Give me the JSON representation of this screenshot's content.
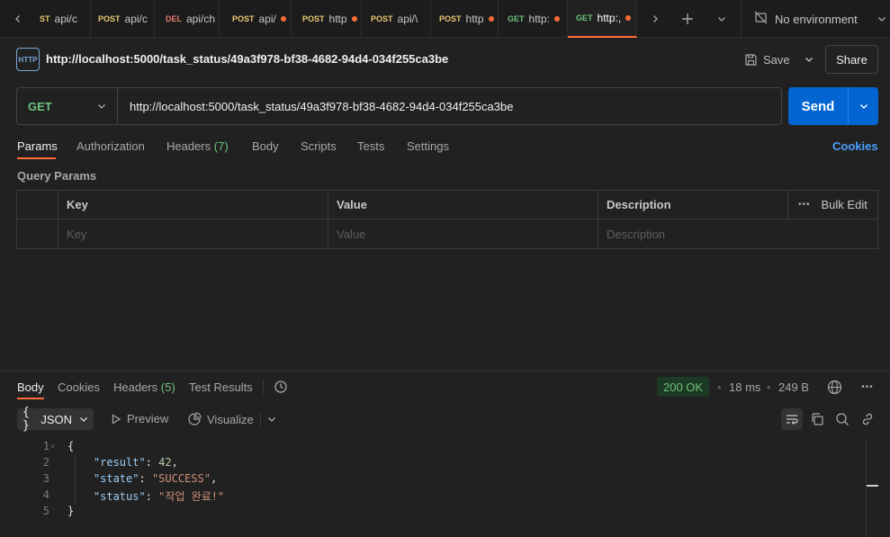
{
  "tabs": [
    {
      "method": "ST",
      "label": "api/c",
      "dot": false,
      "active": false
    },
    {
      "method": "POST",
      "label": "api/c",
      "dot": false,
      "active": false
    },
    {
      "method": "DEL",
      "label": "api/ch",
      "dot": false,
      "active": false
    },
    {
      "method": "POST",
      "label": "api/",
      "dot": true,
      "active": false
    },
    {
      "method": "POST",
      "label": "http",
      "dot": true,
      "active": false
    },
    {
      "method": "POST",
      "label": "api/\\",
      "dot": false,
      "active": false
    },
    {
      "method": "POST",
      "label": "http",
      "dot": true,
      "active": false
    },
    {
      "method": "GET",
      "label": "http:",
      "dot": true,
      "active": false
    },
    {
      "method": "GET",
      "label": "http:,",
      "dot": true,
      "active": true
    }
  ],
  "environment": "No environment",
  "request": {
    "title": "http://localhost:5000/task_status/49a3f978-bf38-4682-94d4-034f255ca3be",
    "method": "GET",
    "url": "http://localhost:5000/task_status/49a3f978-bf38-4682-94d4-034f255ca3be",
    "save_label": "Save",
    "share_label": "Share",
    "send_label": "Send"
  },
  "request_tabs": {
    "params": "Params",
    "authorization": "Authorization",
    "headers": "Headers",
    "headers_count": "(7)",
    "body": "Body",
    "scripts": "Scripts",
    "tests": "Tests",
    "settings": "Settings",
    "cookies": "Cookies"
  },
  "query_params": {
    "label": "Query Params",
    "columns": [
      "Key",
      "Value",
      "Description"
    ],
    "bulk_edit": "Bulk Edit",
    "placeholders": [
      "Key",
      "Value",
      "Description"
    ]
  },
  "response": {
    "tabs": {
      "body": "Body",
      "cookies": "Cookies",
      "headers": "Headers",
      "headers_count": "(5)",
      "test_results": "Test Results"
    },
    "status": "200 OK",
    "time": "18 ms",
    "size": "249 B",
    "format": "JSON",
    "preview": "Preview",
    "visualize": "Visualize",
    "line_numbers": [
      "1",
      "2",
      "3",
      "4",
      "5"
    ],
    "json": {
      "open": "{",
      "k1": "\"result\"",
      "v1": "42",
      "k2": "\"state\"",
      "v2": "\"SUCCESS\"",
      "k3": "\"status\"",
      "v3": "\"작업 완료!\"",
      "close": "}"
    }
  },
  "colors": {
    "accent": "#ff6c37",
    "send": "#0265d2",
    "get": "#6cc27a",
    "post": "#e8c873",
    "delete": "#e07a6a",
    "link": "#4a9fff"
  }
}
